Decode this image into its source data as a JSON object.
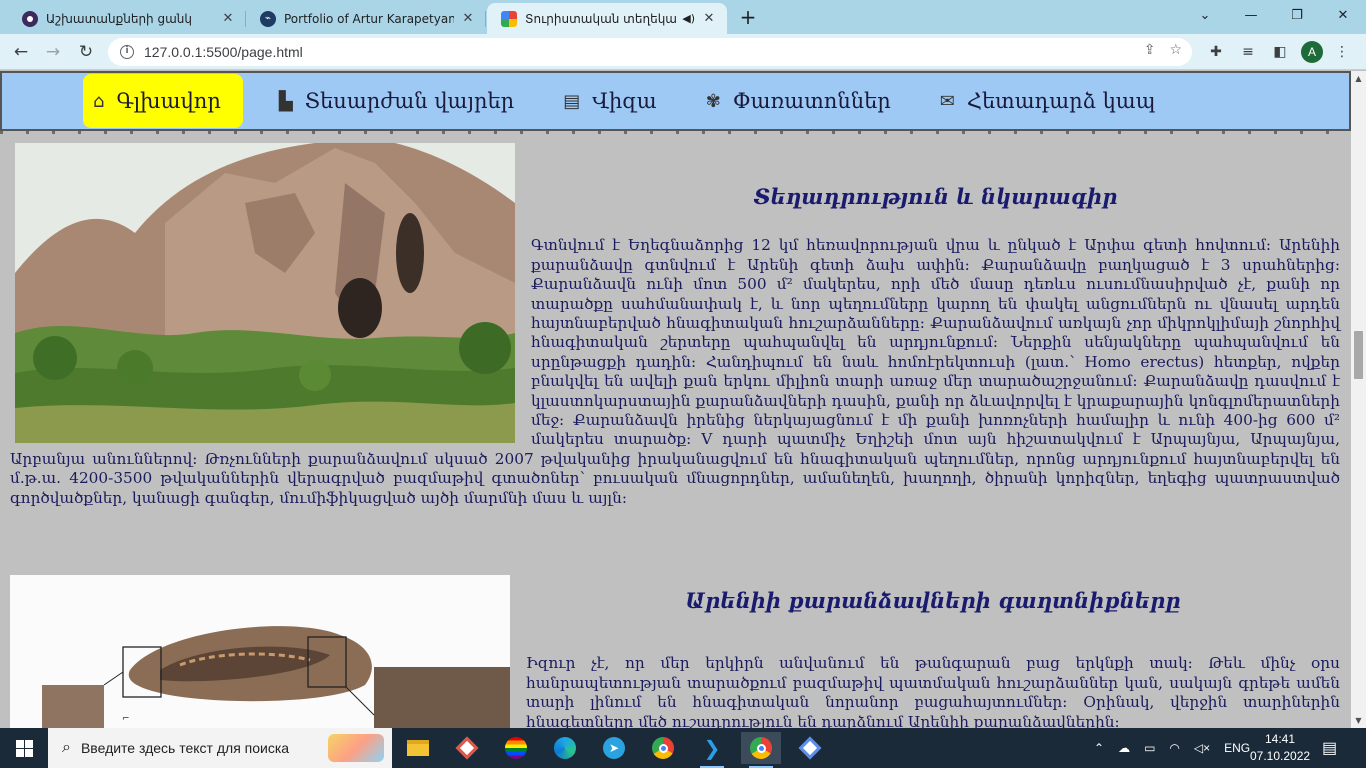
{
  "browser": {
    "tabs": [
      {
        "title": "Աշխատանքների ցանկ",
        "active": false
      },
      {
        "title": "Portfolio of Artur Karapetyan",
        "active": false
      },
      {
        "title": "Տուրիստական տեղեկատու",
        "active": true
      }
    ],
    "url": "127.0.0.1:5500/page.html",
    "profile_initial": "A"
  },
  "site": {
    "nav": [
      {
        "label": "Գլխավոր",
        "icon": "home-icon",
        "active": true
      },
      {
        "label": "Տեսարժան վայրեր",
        "icon": "city-icon",
        "active": false
      },
      {
        "label": "Վիզա",
        "icon": "passport-icon",
        "active": false
      },
      {
        "label": "Փառատոններ",
        "icon": "festival-icon",
        "active": false
      },
      {
        "label": "Հետադարձ կապ",
        "icon": "feedback-mail-icon",
        "active": false
      }
    ],
    "section1": {
      "heading": "Տեղադրություն և նկարագիր",
      "text": "Գտնվում է Եղեգնաձորից 12 կմ հեռավորության վրա և ընկած է Արփա գետի հովտում: Արենիի քարանձավը գտնվում է Արենի գետի ձախ ափին: Քարանձավը բաղկացած է 3 սրահներից: Քարանձավն ունի մոտ 500 մ² մակերես, որի մեծ մասը դեռևս ուսումնասիրված չէ, քանի որ տարածքը սահմանափակ է, և նոր պեղումները կարող են փակել անցումներն ու վնասել արդեն հայտնաբերված հնագիտական հուշարձանները: Քարանձավում առկայն չոր միկրոկլիմայի շնորհիվ հնագիտական շերտերը պահպանվել են արդյունքում: Ներքին սենյակները պահպանվում են սրընթացքի դադին: Հանդիպում են նաև հոմոէրեկտուսի (լատ.՝ Homo erectus) հետքեր, ովքեր բնակվել են ավելի քան երկու միլիոն տարի առաջ մեր տարածաշրջանում: Քարանձավը դասվում է կլաստոկարստային քարանձավների դասին, քանի որ ձևավորվել է կրաքարային կոնգլոմերատների մեջ: Քարանձավն իրենից ներկայացնում է մի քանի խոռոչների համալիր և ունի 400-ից 600 մ² մակերես տարածք: V դարի պատմիչ Եղիշեի մոտ այն հիշատակվում է Արպայնյա, Արպայնյա, Արբանյա անուններով: Թռչունների քարանձավում սկսած 2007 թվականից իրականացվում են հնագիտական պեղումներ, որոնց արդյունքում հայտնաբերվել են մ.թ.ա. 4200-3500 թվականներին վերագրված բազմաթիվ գտածոներ՝ բուսական մնացորդներ, ամանեղեն, խաղողի, ծիրանի կորիզներ, եղեգից պատրաստված գործվածքներ, կանացի գանգեր, մումիֆիկացված այծի մարմնի մաս և այլն:"
    },
    "section2": {
      "heading": "Արենիի քարանձավների գաղտնիքները",
      "text": "Իզուր չէ, որ մեր երկիրն անվանում են թանգարան բաց երկնքի տակ: Թեև մինչ օրս հանրապետության տարածքում բազմաթիվ պատմական հուշարձաններ կան, սակայն գրեթե ամեն տարի լինում են հնագիտական նորանոր բացահայտումներ: Օրինակ, վերջին տարիներին հնագետները մեծ ուշադրություն են դարձնում Արենիի քարանձավներին:"
    }
  },
  "taskbar": {
    "search_placeholder": "Введите здесь текст для поиска",
    "language": "ENG",
    "time": "14:41",
    "date": "07.10.2022"
  }
}
